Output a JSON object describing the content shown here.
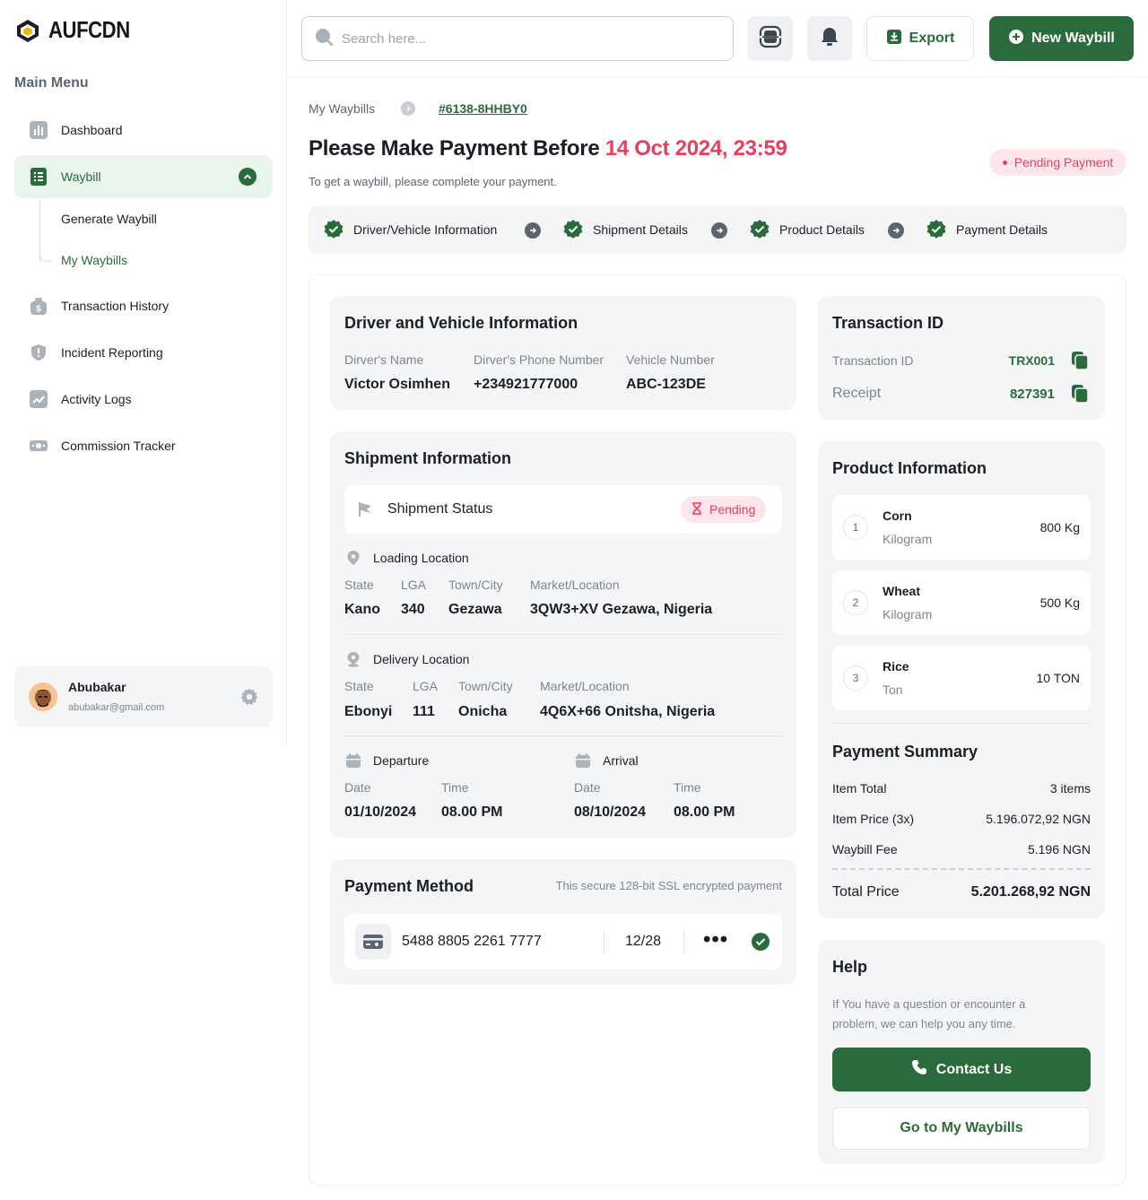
{
  "brand": {
    "name": "AUFCDN"
  },
  "sidebar": {
    "menu_title": "Main Menu",
    "items": [
      {
        "label": "Dashboard",
        "icon": "chart-icon"
      },
      {
        "label": "Waybill",
        "icon": "document-icon",
        "active": true
      },
      {
        "label": "Transaction History",
        "icon": "money-bag-icon"
      },
      {
        "label": "Incident Reporting",
        "icon": "shield-alert-icon"
      },
      {
        "label": "Activity Logs",
        "icon": "activity-icon"
      },
      {
        "label": "Commission Tracker",
        "icon": "cash-icon"
      }
    ],
    "sub_items": [
      {
        "label": "Generate Waybill"
      },
      {
        "label": "My Waybills",
        "active": true
      }
    ],
    "user": {
      "name": "Abubakar",
      "email": "abubakar@gmail.com"
    }
  },
  "topbar": {
    "search_placeholder": "Search here...",
    "export_label": "Export",
    "new_label": "New Waybill"
  },
  "breadcrumb": {
    "parent": "My Waybills",
    "current": "#6138-8HHBY0"
  },
  "header": {
    "title_prefix": "Please Make Payment Before",
    "deadline": "14 Oct 2024, 23:59",
    "subtitle": "To get a waybill, please complete your payment.",
    "status": "Pending Payment"
  },
  "steps": [
    {
      "label": "Driver/Vehicle Information"
    },
    {
      "label": "Shipment Details"
    },
    {
      "label": "Product Details"
    },
    {
      "label": "Payment Details"
    }
  ],
  "driver": {
    "title": "Driver and Vehicle Information",
    "name_label": "Dirver's Name",
    "name": "Victor Osimhen",
    "phone_label": "Dirver's Phone Number",
    "phone": "+234921777000",
    "vehicle_label": "Vehicle Number",
    "vehicle": "ABC-123DE"
  },
  "shipment": {
    "title": "Shipment Information",
    "status_label": "Shipment Status",
    "status": "Pending",
    "loading": {
      "title": "Loading Location",
      "state_label": "State",
      "state": "Kano",
      "lga_label": "LGA",
      "lga": "340",
      "town_label": "Town/City",
      "town": "Gezawa",
      "market_label": "Market/Location",
      "market": "3QW3+XV Gezawa, Nigeria"
    },
    "delivery": {
      "title": "Delivery Location",
      "state_label": "State",
      "state": "Ebonyi",
      "lga_label": "LGA",
      "lga": "111",
      "town_label": "Town/City",
      "town": "Onicha",
      "market_label": "Market/Location",
      "market": "4Q6X+66 Onitsha, Nigeria"
    },
    "departure": {
      "title": "Departure",
      "date_label": "Date",
      "date": "01/10/2024",
      "time_label": "Time",
      "time": "08.00 PM"
    },
    "arrival": {
      "title": "Arrival",
      "date_label": "Date",
      "date": "08/10/2024",
      "time_label": "Time",
      "time": "08.00 PM"
    }
  },
  "payment_method": {
    "title": "Payment Method",
    "note": "This secure 128-bit SSL encrypted payment",
    "card_number": "5488 8805 2261 7777",
    "expiry": "12/28",
    "cvv_mask": "•••"
  },
  "transaction": {
    "title": "Transaction ID",
    "id_label": "Transaction ID",
    "id": "TRX001",
    "receipt_label": "Receipt",
    "receipt": "827391"
  },
  "products": {
    "title": "Product Information",
    "items": [
      {
        "num": "1",
        "name": "Corn",
        "unit": "Kilogram",
        "qty": "800 Kg"
      },
      {
        "num": "2",
        "name": "Wheat",
        "unit": "Kilogram",
        "qty": "500 Kg"
      },
      {
        "num": "3",
        "name": "Rice",
        "unit": "Ton",
        "qty": "10 TON"
      }
    ]
  },
  "summary": {
    "title": "Payment Summary",
    "item_total_label": "Item Total",
    "item_total": "3 items",
    "item_price_label": "Item Price (3x)",
    "item_price": "5.196.072,92 NGN",
    "fee_label": "Waybill Fee",
    "fee": "5.196 NGN",
    "total_label": "Total Price",
    "total": "5.201.268,92 NGN"
  },
  "help": {
    "title": "Help",
    "text": "If You have a question or encounter a problem, we can help you any time.",
    "contact_label": "Contact Us",
    "go_label": "Go to My Waybills"
  },
  "colors": {
    "brand_green": "#2a6b3c",
    "alert_red": "#e5405e",
    "light_green": "#e9f5ea"
  }
}
